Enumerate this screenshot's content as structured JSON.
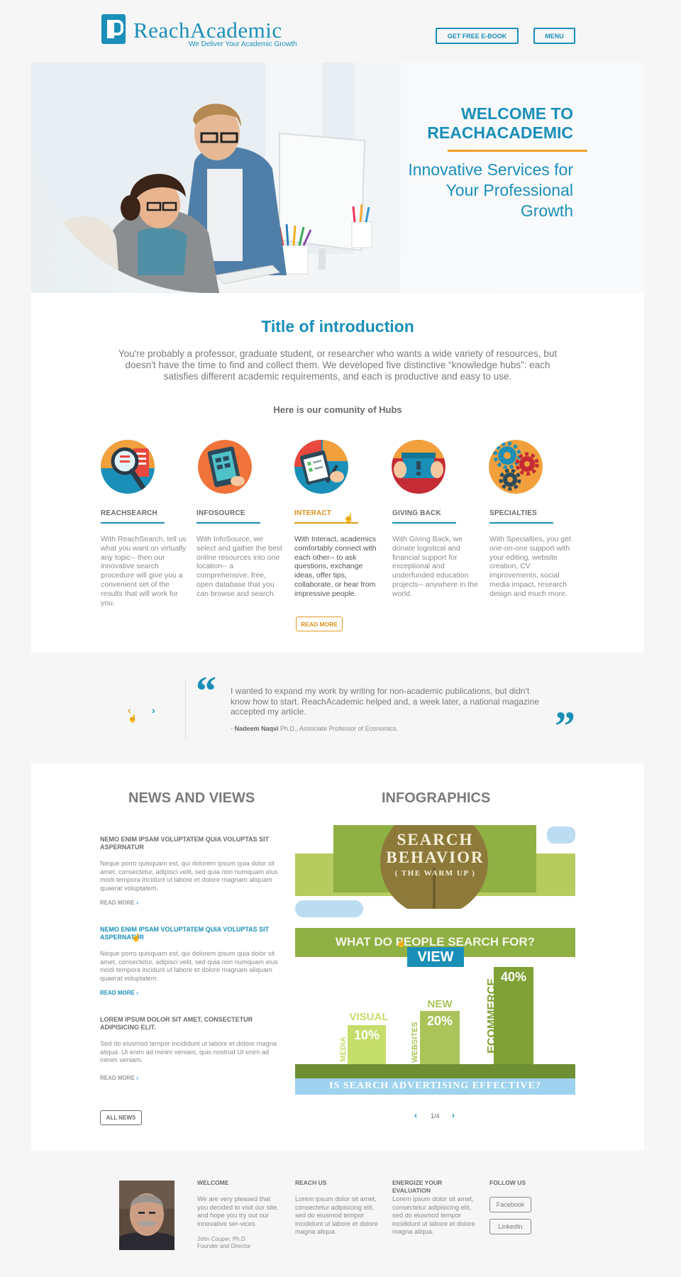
{
  "header": {
    "logo_text": "ReachAcademic",
    "tagline": "We Deliver Your Academic Growth",
    "ebook_button": "GET FREE E-BOOK",
    "menu_button": "MENU"
  },
  "hero": {
    "welcome_line1": "WELCOME TO",
    "welcome_line2": "REACHACADEMIC",
    "subtitle": "Innovative Services for Your Professional Growth"
  },
  "intro": {
    "title": "Title of introduction",
    "text": "You're probably a professor, graduate student, or researcher who wants a wide variety of resources, but doesn't have the time to find and collect them.  We developed five distinctive “knowledge hubs”: each satisfies different academic requirements, and each is productive and easy to use.",
    "hubs_heading": "Here is our comunity of Hubs",
    "read_more": "READ MORE",
    "hubs": [
      {
        "title": "REACHSEARCH",
        "icon": "magnifier-icon",
        "text": "With ReachSearch, tell us what you want on virtually any topic-- then our innovative search procedure will give you a convenient set of the results that will work for you."
      },
      {
        "title": "INFOSOURCE",
        "icon": "tablet-icon",
        "text": "With InfoSource, we select and gather the best online resources into one location-- a comprehensive, free, open database that you can browse and search."
      },
      {
        "title": "INTERACT",
        "icon": "checklist-icon",
        "text": "With Interact, academics comfortably connect with each other-- to ask questions, exchange ideas, offer tips, collaborate, or hear from impressive people."
      },
      {
        "title": "GIVING BACK",
        "icon": "gift-box-icon",
        "text": "With Giving Back, we donate logistical and financial support for exceptional and underfunded education projects-- anywhere in the world."
      },
      {
        "title": "SPECIALTIES",
        "icon": "gears-icon",
        "text": "With Specialties, you get one-on-one support with your editing, website creation, CV improvements, social media impact, research design and much more."
      }
    ],
    "colors": {
      "accent": "#1a8fb8",
      "highlight": "#e29a1e"
    }
  },
  "testimonial": {
    "text": "I wanted to expand my work by writing for non-academic publications, but didn't know how to start. ReachAcademic helped and, a week later, a national magazine accepted my article.",
    "author_name": "Nadeem Naqvi",
    "author_title": "Ph.D., Associate Professor of Economics.",
    "prev_icon": "chevron-left-icon",
    "next_icon": "chevron-right-icon"
  },
  "news": {
    "heading": "NEWS AND VIEWS",
    "items": [
      {
        "title": "NEMO ENIM IPSAM VOLUPTATEM QUIA VOLUPTAS SIT ASPERNATUR",
        "body": "Neque porro quisquam est, qui dolorem ipsum quia dolor sit amet, consectetur, adipisci velit, sed quia non numquam eius modi tempora incidunt ut labore et dolore magnam aliquam quaerat voluptatem.",
        "read_more": "READ MORE"
      },
      {
        "title": "NEMO ENIM IPSAM VOLUPTATEM QUIA VOLUPTAS SIT ASPERNATUR",
        "body": "Neque porro quisquam est, qui dolorem ipsum quia dolor sit amet, consectetur, adipisci velit, sed quia non numquam eius modi tempora incidunt ut labore et dolore magnam aliquam quaerat voluptatem.",
        "read_more": "READ MORE"
      },
      {
        "title": "LOREM IPSUM DOLOR SIT AMET, CONSECTETUR ADIPISICING ELIT.",
        "body": "Sed do eiusmod tempor incididunt ut labore et dolore magna aliqua. Ut enim ad minim veniam, quis nostrud Ut enim ad minim veniam.",
        "read_more": "READ MORE"
      }
    ],
    "all_news": "ALL NEWS"
  },
  "infographics": {
    "heading": "INFOGRAPHICS",
    "banner_line1": "SEARCH",
    "banner_line2": "BEHAVIOR",
    "banner_line3": "( THE WARM UP )",
    "question": "WHAT DO PEOPLE SEARCH FOR?",
    "view_label": "VIEW",
    "bars": [
      {
        "top": "VISUAL",
        "side": "MEDIA",
        "pct": "10%"
      },
      {
        "top": "NEW",
        "side": "WEBSITES",
        "pct": "20%"
      },
      {
        "top": "",
        "side": "ECOMMERCE",
        "pct": "40%"
      }
    ],
    "footer_question": "IS SEARCH ADVERTISING EFFECTIVE?",
    "pager": "1/4"
  },
  "footer": {
    "welcome_heading": "WELCOME",
    "welcome_text": "We are very pleased that you decided to visit our site, and hope you try out our innovative ser-vices.",
    "signature_name": "John Couper, Ph.D.",
    "signature_title": "Founder and Director",
    "reach_heading": "REACH US",
    "reach_text": "Lorem ipsum dolor sit amet, consectetur adipisicing elit, sed do eiusmod tempor incididunt ut labore et dolore magna aliqua.",
    "energize_heading": "ENERGIZE YOUR EVALUATION",
    "energize_text": "Lorem ipsum dolor sit amet, consectetur adipisicing elit, sed do eiusmod tempor incididunt ut labore et dolore magna aliqua.",
    "follow_heading": "FOLLOW US",
    "facebook": "Facebook",
    "linkedin": "LinkedIn"
  }
}
